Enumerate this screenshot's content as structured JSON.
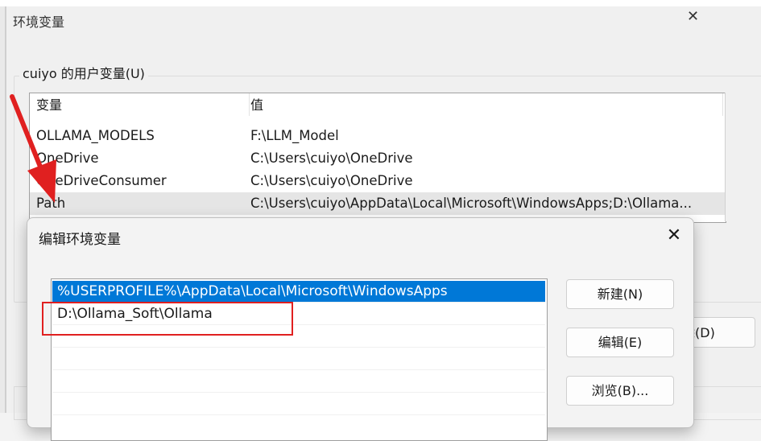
{
  "outer_window": {
    "title": "环境变量",
    "user_group_label": "cuiyo 的用户变量(U)",
    "columns": [
      "变量",
      "值"
    ],
    "rows": [
      {
        "name": "OLLAMA_MODELS",
        "value": "F:\\LLM_Model"
      },
      {
        "name": "OneDrive",
        "value": "C:\\Users\\cuiyo\\OneDrive"
      },
      {
        "name": "OneDriveConsumer",
        "value": "C:\\Users\\cuiyo\\OneDrive"
      },
      {
        "name": "Path",
        "value": "C:\\Users\\cuiyo\\AppData\\Local\\Microsoft\\WindowsApps;D:\\Ollama..."
      }
    ],
    "delete_button_partial": "除(D)",
    "close_icon": "close-icon"
  },
  "edit_dialog": {
    "title": "编辑环境变量",
    "close_icon": "close-icon",
    "path_entries": [
      "%USERPROFILE%\\AppData\\Local\\Microsoft\\WindowsApps",
      "D:\\Ollama_Soft\\Ollama"
    ],
    "buttons": {
      "new_label": "新建(N)",
      "edit_label": "编辑(E)",
      "browse_label": "浏览(B)..."
    }
  },
  "colors": {
    "selection": "#0078d7",
    "annotation_red": "#e02020"
  }
}
